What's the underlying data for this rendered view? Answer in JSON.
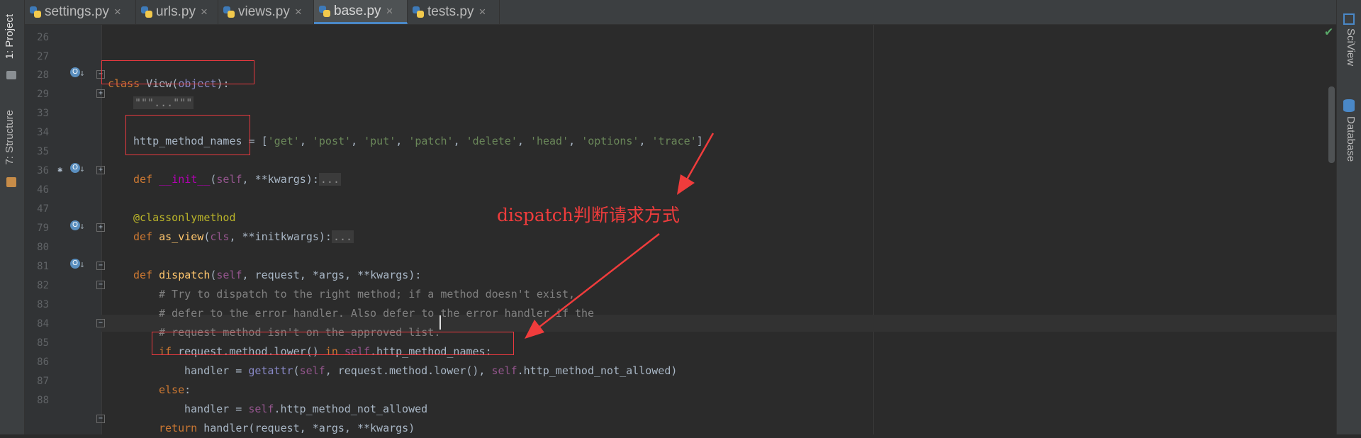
{
  "tabs": [
    {
      "label": "settings.py",
      "active": false
    },
    {
      "label": "urls.py",
      "active": false
    },
    {
      "label": "views.py",
      "active": false
    },
    {
      "label": "base.py",
      "active": true
    },
    {
      "label": "tests.py",
      "active": false
    }
  ],
  "close_glyph": "×",
  "left_panel": {
    "project_tab": "1: Project",
    "structure_tab": "7: Structure"
  },
  "right_panel": {
    "sciview_tab": "SciView",
    "database_tab": "Database"
  },
  "line_numbers": [
    "26",
    "27",
    "28",
    "29",
    "33",
    "34",
    "35",
    "36",
    "46",
    "47",
    "79",
    "80",
    "81",
    "82",
    "83",
    "84",
    "85",
    "86",
    "87",
    "88"
  ],
  "code": {
    "class_kw": "class",
    "class_name": " View(",
    "class_base": "object",
    "class_end": "):",
    "docstring_fold": "\"\"\"...\"\"\"",
    "attr_name": "http_method_names",
    "attr_eq": " = [",
    "methods": [
      "'get'",
      "'post'",
      "'put'",
      "'patch'",
      "'delete'",
      "'head'",
      "'options'",
      "'trace'"
    ],
    "list_sep": ", ",
    "attr_close": "]",
    "def_kw": "def ",
    "init_name": "__init__",
    "init_args_self": "self",
    "init_args_rest": ", **kwargs):",
    "fold_dots": "...",
    "decorator": "@classonlymethod",
    "as_view_name": "as_view",
    "as_view_cls": "cls",
    "as_view_rest": ", **initkwargs):",
    "dispatch_name": "dispatch",
    "dispatch_self": "self",
    "dispatch_rest": ", request, *args, **kwargs):",
    "comment1": "# Try to dispatch to the right method; if a method doesn't exist,",
    "comment2": "# defer to the error handler. Also defer to the error handler if the",
    "comment3": "# request method isn't on the approved list.",
    "if_kw": "if",
    "if_cond": " request.method.lower() ",
    "in_kw": "in",
    "if_self": " self",
    "if_rest": ".http_method_names:",
    "handler_assign": "handler = ",
    "getattr_name": "getattr",
    "getattr_open": "(",
    "getattr_self": "self",
    "getattr_mid": ", request.method.lower(), ",
    "getattr_self2": "self",
    "getattr_end": ".http_method_not_allowed)",
    "else_kw": "else",
    "else_colon": ":",
    "handler_assign2": "handler = ",
    "self3": "self",
    "not_allowed": ".http_method_not_allowed",
    "return_kw": "return",
    "return_rest": " handler(request, *args, **kwargs)"
  },
  "annotation": "dispatch判断请求方式",
  "inspection_status": "✔",
  "colors": {
    "annotation_red": "#f03c3c",
    "background": "#2b2b2b",
    "keyword": "#cc7832",
    "string": "#6a8759"
  }
}
